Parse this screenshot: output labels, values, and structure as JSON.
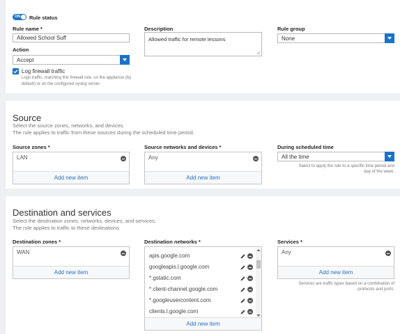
{
  "colors": {
    "accent": "#1a73c9",
    "link": "#2a6fc0",
    "background": "#eef0f3"
  },
  "rule": {
    "toggle_label": "ON",
    "status_label": "Rule status",
    "name_label": "Rule name *",
    "name_value": "Allowed School Suff",
    "description_label": "Description",
    "description_value": "Allowed traffic for remote lessons",
    "group_label": "Rule group",
    "group_value": "None",
    "action_label": "Action",
    "action_value": "Accept",
    "log_label": "Log firewall traffic",
    "log_checked": true,
    "log_hint_line1": "Logs traffic, matching this firewall rule, on the appliance (by",
    "log_hint_line2": "default) or on the configured syslog server."
  },
  "source": {
    "title": "Source",
    "subtitle1": "Select the source zones, networks, and devices.",
    "subtitle2": "The rule applies to traffic from these sources during the scheduled time period.",
    "zones_label": "Source zones *",
    "zones": [
      "LAN"
    ],
    "networks_label": "Source networks and devices *",
    "networks": [
      "Any"
    ],
    "schedule_label": "During scheduled time",
    "schedule_value": "All the time",
    "schedule_hint1": "Select to apply the rule to a specific time period and",
    "schedule_hint2": "day of the week.",
    "add_label": "Add new item"
  },
  "destination": {
    "title": "Destination and services",
    "subtitle1": "Select the destination zones, networks, devices, and services.",
    "subtitle2": "The rule applies to traffic to these destinations.",
    "zones_label": "Destination zones *",
    "zones": [
      "WAN"
    ],
    "networks_label": "Destination networks *",
    "networks": [
      "apis.google.com",
      "googleapis.l.google.com",
      "*.gstatic.com",
      "*.client-channel.google.com",
      "*.googleusercontent.com",
      "clients.l.google.com"
    ],
    "services_label": "Services *",
    "services": [
      "Any"
    ],
    "services_hint1": "Services are traffic types based on a combination of",
    "services_hint2": "protocols and ports.",
    "add_label": "Add new item"
  }
}
